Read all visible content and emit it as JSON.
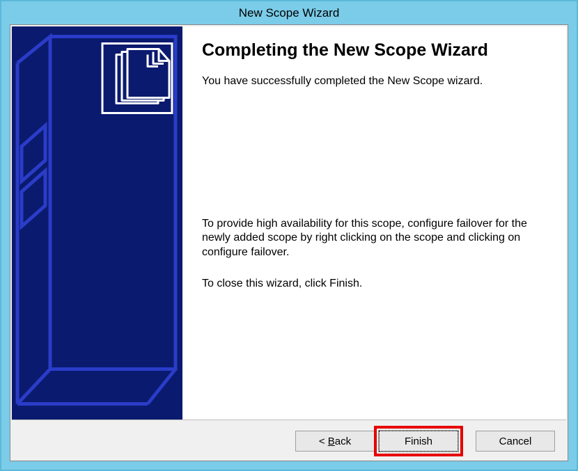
{
  "window": {
    "title": "New Scope Wizard"
  },
  "page": {
    "heading": "Completing the New Scope Wizard",
    "successText": "You have successfully completed the New Scope wizard.",
    "failoverText": "To provide high availability for this scope, configure failover for the newly added scope by right clicking on the scope and clicking on configure failover.",
    "closeText": "To close this wizard, click Finish."
  },
  "buttons": {
    "backPrefix": "< ",
    "backAccel": "B",
    "backRest": "ack",
    "finish": "Finish",
    "cancel": "Cancel"
  }
}
